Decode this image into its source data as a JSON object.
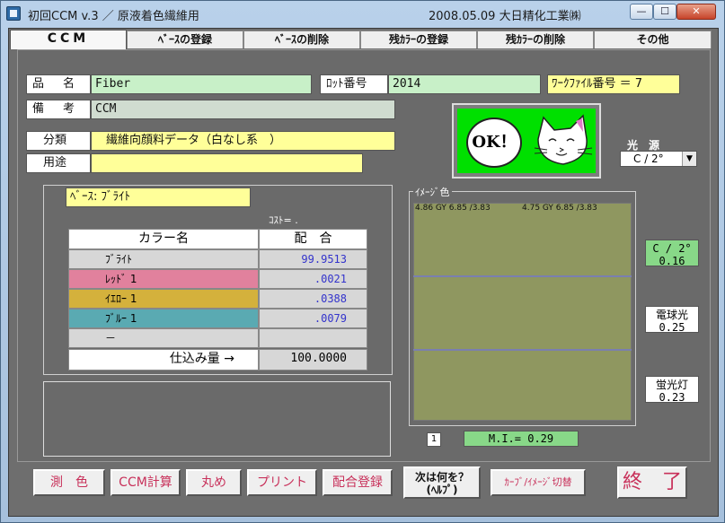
{
  "window": {
    "title": "初回CCM  v.3 ／ 原液着色繊維用",
    "title_right": "2008.05.09  大日精化工業㈱",
    "minimize": "—",
    "maximize": "☐",
    "close": "✕"
  },
  "tabs": [
    "CCM",
    "ﾍﾞｰｽの登録",
    "ﾍﾞｰｽの削除",
    "残ｶﾗｰの登録",
    "残ｶﾗｰの削除",
    "その他"
  ],
  "fields": {
    "product_label": "品　名",
    "product_value": "Fiber",
    "lot_label": "ﾛｯﾄ番号",
    "lot_value": "2014",
    "workfile": "ﾜｰｸﾌｧｲﾙ番号 ＝ 7",
    "remark_label": "備　考",
    "remark_value": "CCM",
    "category_label": "分類",
    "category_value": "繊維向顔料データ（白なし系　）",
    "usage_label": "用途",
    "usage_value": ""
  },
  "ok_panel": {
    "text": "OK！"
  },
  "light_source": {
    "label": "光　源",
    "selected": "C / 2°"
  },
  "base": {
    "label": "ﾍﾞｰｽ: ﾌﾞﾗｲﾄ",
    "cost_label": "ｺｽﾄ= ."
  },
  "table": {
    "headers": [
      "カラー名",
      "配　合"
    ],
    "rows": [
      {
        "name": "ﾌﾞﾗｲﾄ",
        "value": "99.9513",
        "color": "#d7d7d7"
      },
      {
        "name": "ﾚｯﾄﾞ 1",
        "value": ".0021",
        "color": "#e1819d"
      },
      {
        "name": "ｲｴﾛｰ 1",
        "value": ".0388",
        "color": "#d4b13c"
      },
      {
        "name": "ﾌﾞﾙｰ 1",
        "value": ".0079",
        "color": "#5aaab2"
      },
      {
        "name": "－",
        "value": "",
        "color": "#d7d7d7"
      }
    ],
    "total_label": "仕込み量 →",
    "total_value": "100.0000"
  },
  "image_color": {
    "label": "ｲﾒｰｼﾞ色",
    "left_value": "4.86 GY 6.85 /3.83",
    "right_value": "4.75 GY 6.85 /3.83",
    "swatch": "#8f9760"
  },
  "page_num": "1",
  "mi": "M.I.= 0.29",
  "side": [
    {
      "name": "C / 2°",
      "value": "0.16",
      "bg": "#88d888"
    },
    {
      "name": "電球光",
      "value": "0.25",
      "bg": "#ffffff"
    },
    {
      "name": "蛍光灯",
      "value": "0.23",
      "bg": "#ffffff"
    }
  ],
  "buttons": {
    "measure": "測　色",
    "ccm_calc": "CCM計算",
    "round": "丸め",
    "print": "プリント",
    "register": "配合登録",
    "next_help": "次は何を？",
    "next_help_sub": "(ﾍﾙﾌﾟ)",
    "curve": "ｶｰﾌﾞ/ｲﾒｰｼﾞ切替",
    "exit": "終　了"
  }
}
